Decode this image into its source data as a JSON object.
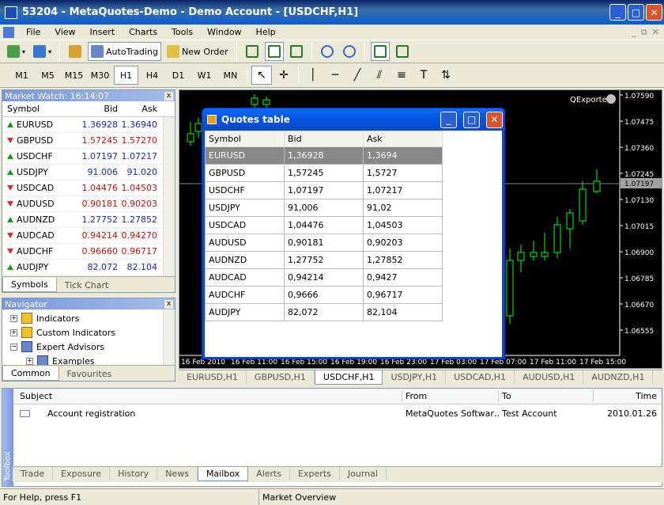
{
  "window": {
    "title": "53204 - MetaQuotes-Demo - Demo Account - [USDCHF,H1]",
    "min": "_",
    "max": "□",
    "close": "✕"
  },
  "menu": [
    "File",
    "View",
    "Insert",
    "Charts",
    "Tools",
    "Window",
    "Help"
  ],
  "mdi": {
    "min": "_",
    "restore": "⧉",
    "close": "✕"
  },
  "toolbar": {
    "autotrading": "AutoTrading",
    "new_order": "New Order"
  },
  "timeframes": [
    "M1",
    "M5",
    "M15",
    "M30",
    "H1",
    "H4",
    "D1",
    "W1",
    "MN"
  ],
  "active_timeframe": "H1",
  "market_watch": {
    "title": "Market Watch: 16:14:07",
    "close": "x",
    "headers": {
      "symbol": "Symbol",
      "bid": "Bid",
      "ask": "Ask"
    },
    "rows": [
      {
        "symbol": "EURUSD",
        "bid": "1.36928",
        "ask": "1.36940",
        "dir": "up",
        "color": "blue"
      },
      {
        "symbol": "GBPUSD",
        "bid": "1.57245",
        "ask": "1.57270",
        "dir": "down",
        "color": "red"
      },
      {
        "symbol": "USDCHF",
        "bid": "1.07197",
        "ask": "1.07217",
        "dir": "up",
        "color": "blue"
      },
      {
        "symbol": "USDJPY",
        "bid": "91.006",
        "ask": "91.020",
        "dir": "up",
        "color": "blue"
      },
      {
        "symbol": "USDCAD",
        "bid": "1.04476",
        "ask": "1.04503",
        "dir": "down",
        "color": "red"
      },
      {
        "symbol": "AUDUSD",
        "bid": "0.90181",
        "ask": "0.90203",
        "dir": "down",
        "color": "red"
      },
      {
        "symbol": "AUDNZD",
        "bid": "1.27752",
        "ask": "1.27852",
        "dir": "up",
        "color": "blue"
      },
      {
        "symbol": "AUDCAD",
        "bid": "0.94214",
        "ask": "0.94270",
        "dir": "down",
        "color": "red"
      },
      {
        "symbol": "AUDCHF",
        "bid": "0.96660",
        "ask": "0.96717",
        "dir": "down",
        "color": "red"
      },
      {
        "symbol": "AUDJPY",
        "bid": "82.072",
        "ask": "82.104",
        "dir": "up",
        "color": "blue"
      }
    ],
    "tabs": [
      "Symbols",
      "Tick Chart"
    ]
  },
  "navigator": {
    "title": "Navigator",
    "close": "x",
    "items": [
      {
        "label": "Indicators",
        "exp": "+"
      },
      {
        "label": "Custom Indicators",
        "exp": "+"
      },
      {
        "label": "Expert Advisors",
        "exp": "−"
      },
      {
        "label": "Examples",
        "exp": "+"
      }
    ],
    "tabs": [
      "Common",
      "Favourites"
    ]
  },
  "chart": {
    "label": "QExporter",
    "price_labels": [
      "1.07590",
      "1.07475",
      "1.07360",
      "1.07245",
      "1.07130",
      "1.07015",
      "1.06900",
      "1.06785",
      "1.06670",
      "1.06555"
    ],
    "current_price": "1.07197",
    "time_labels": [
      "16 Feb 2010",
      "16 Feb 11:00",
      "16 Feb 15:00",
      "16 Feb 19:00",
      "16 Feb 23:00",
      "17 Feb 03:00",
      "17 Feb 07:00",
      "17 Feb 11:00",
      "17 Feb 15:00"
    ],
    "tabs": [
      "EURUSD,H1",
      "GBPUSD,H1",
      "USDCHF,H1",
      "USDJPY,H1",
      "USDCAD,H1",
      "AUDUSD,H1",
      "AUDNZD,H1"
    ],
    "active_tab": "USDCHF,H1"
  },
  "dialog": {
    "title": "Quotes table",
    "headers": [
      "Symbol",
      "Bid",
      "Ask"
    ],
    "rows": [
      [
        "EURUSD",
        "1,36928",
        "1,3694"
      ],
      [
        "GBPUSD",
        "1,57245",
        "1,5727"
      ],
      [
        "USDCHF",
        "1,07197",
        "1,07217"
      ],
      [
        "USDJPY",
        "91,006",
        "91,02"
      ],
      [
        "USDCAD",
        "1,04476",
        "1,04503"
      ],
      [
        "AUDUSD",
        "0,90181",
        "0,90203"
      ],
      [
        "AUDNZD",
        "1,27752",
        "1,27852"
      ],
      [
        "AUDCAD",
        "0,94214",
        "0,9427"
      ],
      [
        "AUDCHF",
        "0,9666",
        "0,96717"
      ],
      [
        "AUDJPY",
        "82,072",
        "82,104"
      ]
    ]
  },
  "toolbox": {
    "side_label": "Toolbox",
    "headers": {
      "subject": "Subject",
      "from": "From",
      "to": "To",
      "time": "Time"
    },
    "rows": [
      {
        "subject": "Account registration",
        "from": "MetaQuotes Softwar…",
        "to": "Test Account",
        "time": "2010.01.26"
      }
    ],
    "tabs": [
      "Trade",
      "Exposure",
      "History",
      "News",
      "Mailbox",
      "Alerts",
      "Experts",
      "Journal"
    ],
    "active_tab": "Mailbox"
  },
  "status": {
    "help": "For Help, press F1",
    "profile": "Market Overview"
  }
}
